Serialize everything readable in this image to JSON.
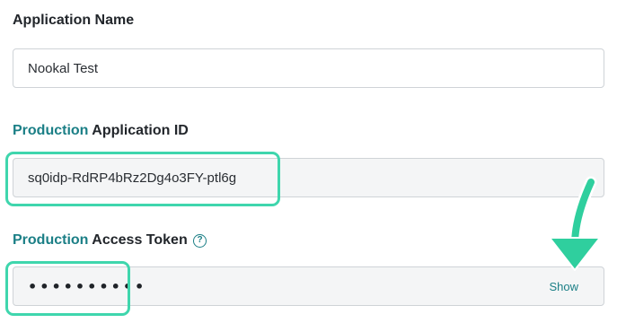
{
  "app_name": {
    "label": "Application Name",
    "value": "Nookal Test"
  },
  "app_id": {
    "label_accent": "Production",
    "label_rest": " Application ID",
    "value": "sq0idp-RdRP4bRz2Dg4o3FY-ptl6g"
  },
  "access_token": {
    "label_accent": "Production",
    "label_rest": " Access Token",
    "masked_value": "••••••••••",
    "show_label": "Show",
    "help_glyph": "?"
  },
  "icons": {
    "help": "question-circle-icon",
    "arrow": "arrow-down-icon"
  },
  "colors": {
    "accent": "#1b7f86",
    "highlight": "#3fd6ad",
    "readonly_bg": "#f4f5f6"
  }
}
